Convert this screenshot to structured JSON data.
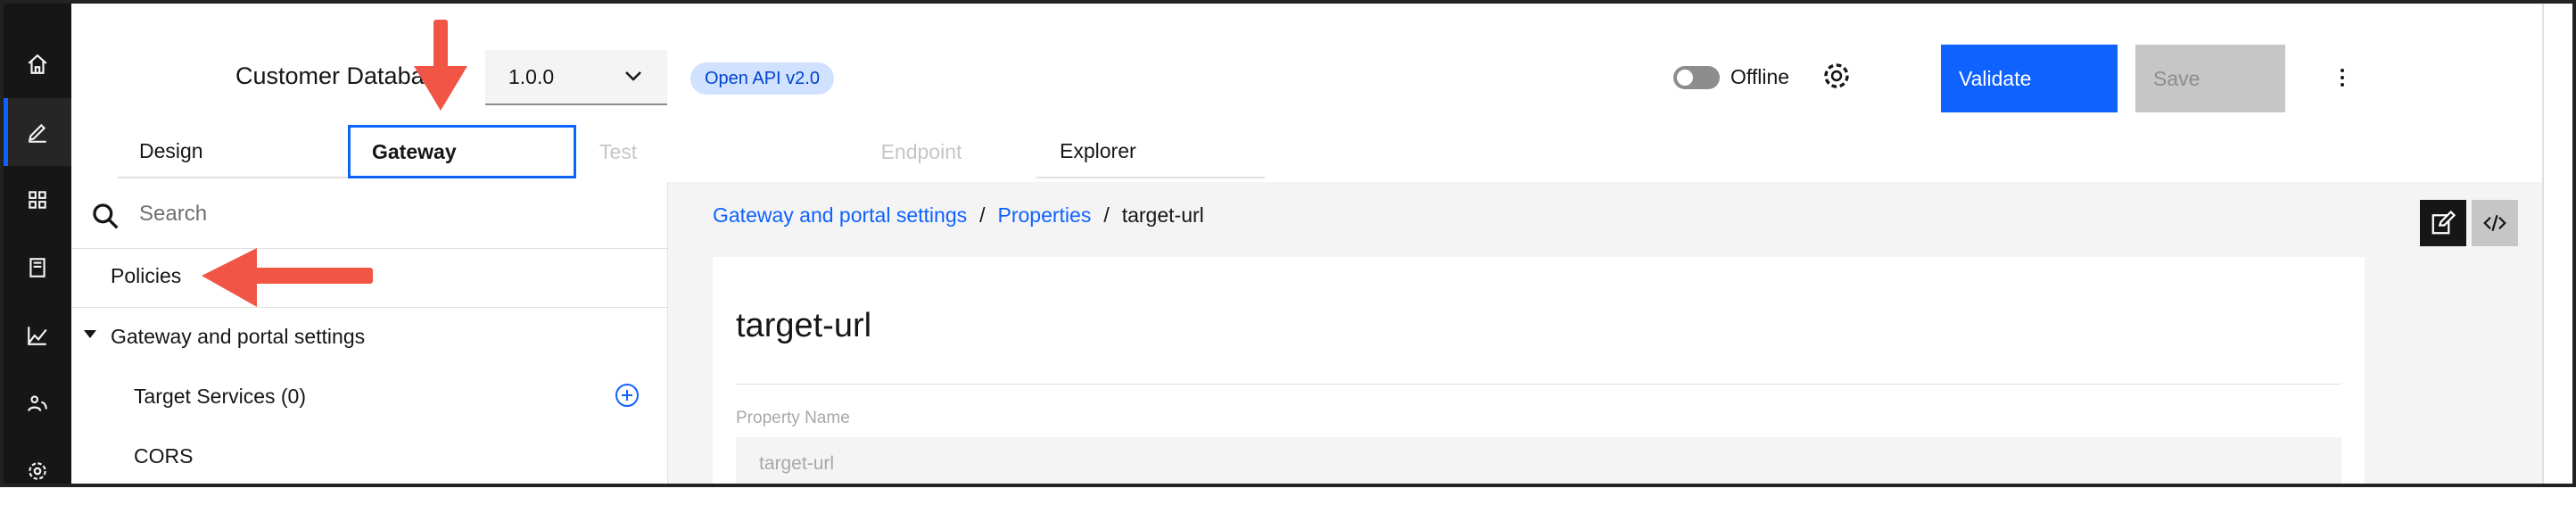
{
  "header": {
    "api_title": "Customer Database",
    "version": "1.0.0",
    "api_type_tag": "Open API v2.0",
    "offline_label": "Offline",
    "validate_label": "Validate",
    "save_label": "Save"
  },
  "tabs": [
    "Design",
    "Gateway",
    "Test",
    "Endpoint",
    "Explorer"
  ],
  "sidebar": {
    "search_placeholder": "Search",
    "policies_label": "Policies",
    "group_label": "Gateway and portal settings",
    "items": [
      "Target Services (0)",
      "CORS"
    ]
  },
  "main": {
    "breadcrumb": [
      "Gateway and portal settings",
      "Properties",
      "target-url"
    ],
    "heading": "target-url",
    "field_label": "Property Name",
    "field_value": "target-url"
  },
  "rail_icons": [
    "home-icon",
    "edit-icon",
    "apps-icon",
    "catalog-icon",
    "analytics-icon",
    "users-icon",
    "settings-icon"
  ],
  "colors": {
    "accent": "#0f62fe",
    "rail_bg": "#161616",
    "annotation_arrow": "#f05545"
  }
}
